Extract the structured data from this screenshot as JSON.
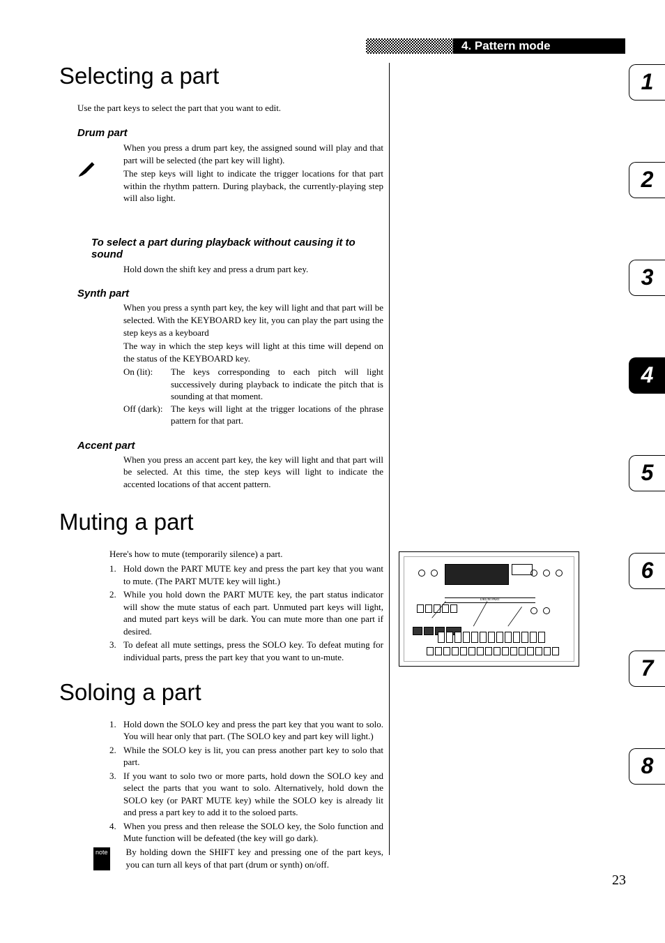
{
  "header": {
    "title": "4. Pattern mode"
  },
  "tabs": [
    "1",
    "2",
    "3",
    "4",
    "5",
    "6",
    "7",
    "8"
  ],
  "active_tab_index": 3,
  "page_number": "23",
  "sections": {
    "selecting": {
      "title": "Selecting a part",
      "intro": "Use the part keys to select the part that you want to edit.",
      "drum": {
        "heading": "Drum part",
        "p1": "When you press a drum part key, the assigned sound will play and that part will be selected (the part key will light).",
        "p2": "The step keys will light to indicate the trigger locations for that part within the rhythm pattern. During playback, the currently-playing step will also light."
      },
      "playback": {
        "heading": "To select a part during playback without causing it to sound",
        "p1": "Hold down the shift key and press a drum part key."
      },
      "synth": {
        "heading": "Synth part",
        "p1": "When you press a synth part key, the key will light and that part will be selected. With the KEYBOARD key lit, you can play the part using the step keys as a keyboard",
        "p2": "The way in which the step keys will light at this time will depend on the status of the KEYBOARD key.",
        "on_label": "On (lit):",
        "on_body": "The keys corresponding to each pitch will light successively during playback to indicate the pitch that is sounding at that moment.",
        "off_label": "Off (dark):",
        "off_body": "The keys will light at the trigger locations of the phrase pattern for that part."
      },
      "accent": {
        "heading": "Accent part",
        "p1": "When you press an accent part key, the key will light and that part will be selected. At this time, the step keys will light to indicate the accented locations of that accent pattern."
      }
    },
    "muting": {
      "title": "Muting a part",
      "intro": "Here's how to mute (temporarily silence) a part.",
      "steps": [
        "Hold down the PART MUTE key and press the part key that you want to mute. (The PART MUTE key will light.)",
        "While you hold down the PART MUTE key, the part status indicator will show the mute status of each part. Unmuted part keys will light, and muted part keys will be dark. You can mute more than one part if desired.",
        "To defeat all mute settings, press the SOLO key. To defeat muting for individual parts, press the part key that you want to un-mute."
      ]
    },
    "soloing": {
      "title": "Soloing a part",
      "steps": [
        "Hold down the SOLO key and press the part key that you want to solo. You will hear only that part. (The SOLO key and part key will light.)",
        "While the SOLO key is lit, you can press another part key to solo that part.",
        "If you want to solo two or more parts, hold down the SOLO key and select the parts that you want to solo. Alternatively, hold down the SOLO key (or PART MUTE key) while the SOLO key is already lit and press a part key to add it to the soloed parts.",
        "When you press and then release the SOLO key, the Solo function and Mute function will be defeated (the key will go dark)."
      ],
      "note_label": "note",
      "note": "By holding down the SHIFT key and pressing one of the part keys, you can turn all keys of that part (drum or synth) on/off."
    }
  }
}
